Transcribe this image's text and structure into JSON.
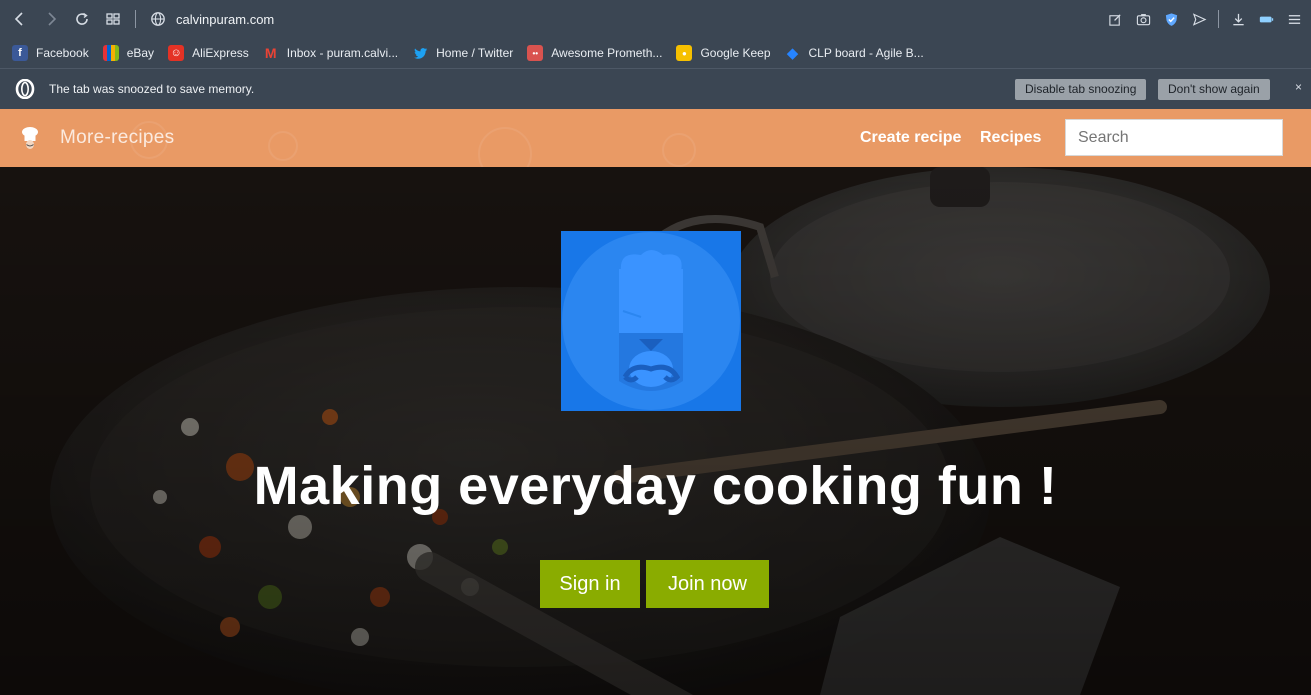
{
  "browser": {
    "url": "calvinpuram.com",
    "bookmarks": [
      {
        "label": "Facebook",
        "icon": "facebook-icon",
        "color": "#3b5998",
        "glyph": "f"
      },
      {
        "label": "eBay",
        "icon": "ebay-icon",
        "color": "#e53238",
        "glyph": ""
      },
      {
        "label": "AliExpress",
        "icon": "aliexpress-icon",
        "color": "#e43225",
        "glyph": "☺"
      },
      {
        "label": "Inbox - puram.calvi...",
        "icon": "gmail-icon",
        "color": "#ffffff",
        "glyph": "M"
      },
      {
        "label": "Home / Twitter",
        "icon": "twitter-icon",
        "color": "#1da1f2",
        "glyph": "🐦"
      },
      {
        "label": "Awesome Prometh...",
        "icon": "prometheus-icon",
        "color": "#d9534f",
        "glyph": "••"
      },
      {
        "label": "Google Keep",
        "icon": "keep-icon",
        "color": "#f6c000",
        "glyph": "●"
      },
      {
        "label": "CLP board - Agile B...",
        "icon": "jira-icon",
        "color": "#2684ff",
        "glyph": "◆"
      }
    ],
    "snooze": {
      "message": "The tab was snoozed to save memory.",
      "disable_label": "Disable tab snoozing",
      "dont_show_label": "Don't show again",
      "close_label": "×"
    }
  },
  "site": {
    "brand": "More-recipes",
    "nav": {
      "create_recipe": "Create recipe",
      "recipes": "Recipes",
      "search_placeholder": "Search"
    },
    "hero": {
      "headline": "Making everyday cooking fun !",
      "sign_in": "Sign in",
      "join_now": "Join now"
    }
  },
  "colors": {
    "browser_chrome": "#3b4653",
    "nav_bg": "#e99a65",
    "logo_bg": "#1877e8",
    "cta_bg": "#8aac00"
  }
}
